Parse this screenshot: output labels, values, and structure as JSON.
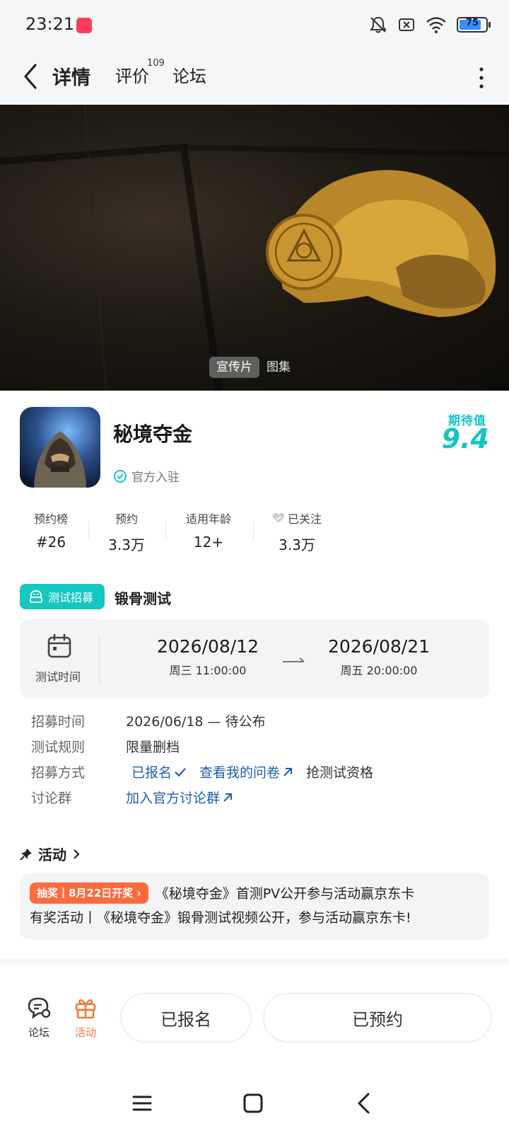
{
  "status_bar": {
    "time": "23:21",
    "battery": "75",
    "icons": [
      "app-notification-icon",
      "bell-off-icon",
      "sim-off-icon",
      "wifi-icon",
      "battery-icon"
    ]
  },
  "nav": {
    "tabs": [
      {
        "label": "详情",
        "active": true
      },
      {
        "label": "评价",
        "badge": "109"
      },
      {
        "label": "论坛"
      }
    ]
  },
  "hero": {
    "segments": [
      "宣传片",
      "图集"
    ],
    "active_segment": "宣传片"
  },
  "game": {
    "title": "秘境夺金",
    "official_label": "官方入驻",
    "expect_label": "期待值",
    "expect_score": "9.4",
    "stats": [
      {
        "label": "预约榜",
        "value": "#26"
      },
      {
        "label": "预约",
        "value": "3.3万"
      },
      {
        "label": "适用年龄",
        "value": "12+"
      },
      {
        "label": "已关注",
        "value": "3.3万"
      }
    ]
  },
  "test": {
    "badge": "测试招募",
    "name": "锻骨测试",
    "time_label": "测试时间",
    "start_date": "2026/08/12",
    "start_time": "周三  11:00:00",
    "end_date": "2026/08/21",
    "end_time": "周五  20:00:00",
    "rows": [
      {
        "key": "招募时间",
        "value": "2026/06/18 — 待公布"
      },
      {
        "key": "测试规则",
        "value": "限量删档"
      },
      {
        "key": "招募方式",
        "value": ""
      },
      {
        "key": "讨论群",
        "value": ""
      }
    ],
    "signed_up": "已报名",
    "view_survey": "查看我的问卷",
    "grab_label": "抢测试资格",
    "join_group": "加入官方讨论群"
  },
  "activity": {
    "header": "活动",
    "badge": "抽奖丨8月22日开奖",
    "line1": "《秘境夺金》首测PV公开参与活动赢京东卡",
    "line2": "有奖活动丨《秘境夺金》锻骨测试视频公开，参与活动赢京东卡!"
  },
  "bottom_bar": {
    "forum_label": "论坛",
    "activity_label": "活动",
    "registered_button": "已报名",
    "reserved_button": "已预约"
  },
  "colors": {
    "accent": "#15c5c5",
    "link": "#1f5fa8",
    "lottery": "#ff6a3d",
    "activity_tab": "#ef7a3a"
  }
}
